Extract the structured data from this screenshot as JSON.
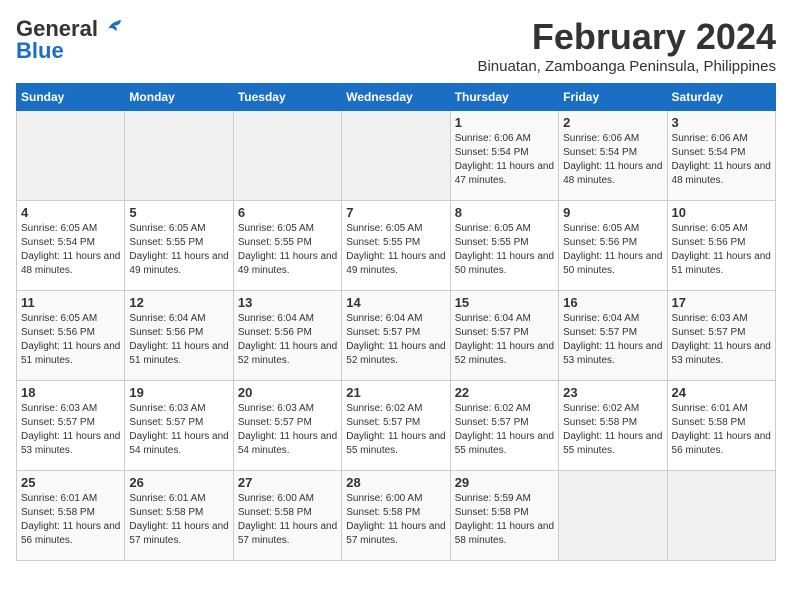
{
  "header": {
    "logo_general": "General",
    "logo_blue": "Blue",
    "month_year": "February 2024",
    "location": "Binuatan, Zamboanga Peninsula, Philippines"
  },
  "days_of_week": [
    "Sunday",
    "Monday",
    "Tuesday",
    "Wednesday",
    "Thursday",
    "Friday",
    "Saturday"
  ],
  "weeks": [
    [
      {
        "day": "",
        "info": ""
      },
      {
        "day": "",
        "info": ""
      },
      {
        "day": "",
        "info": ""
      },
      {
        "day": "",
        "info": ""
      },
      {
        "day": "1",
        "info": "Sunrise: 6:06 AM\nSunset: 5:54 PM\nDaylight: 11 hours and 47 minutes."
      },
      {
        "day": "2",
        "info": "Sunrise: 6:06 AM\nSunset: 5:54 PM\nDaylight: 11 hours and 48 minutes."
      },
      {
        "day": "3",
        "info": "Sunrise: 6:06 AM\nSunset: 5:54 PM\nDaylight: 11 hours and 48 minutes."
      }
    ],
    [
      {
        "day": "4",
        "info": "Sunrise: 6:05 AM\nSunset: 5:54 PM\nDaylight: 11 hours and 48 minutes."
      },
      {
        "day": "5",
        "info": "Sunrise: 6:05 AM\nSunset: 5:55 PM\nDaylight: 11 hours and 49 minutes."
      },
      {
        "day": "6",
        "info": "Sunrise: 6:05 AM\nSunset: 5:55 PM\nDaylight: 11 hours and 49 minutes."
      },
      {
        "day": "7",
        "info": "Sunrise: 6:05 AM\nSunset: 5:55 PM\nDaylight: 11 hours and 49 minutes."
      },
      {
        "day": "8",
        "info": "Sunrise: 6:05 AM\nSunset: 5:55 PM\nDaylight: 11 hours and 50 minutes."
      },
      {
        "day": "9",
        "info": "Sunrise: 6:05 AM\nSunset: 5:56 PM\nDaylight: 11 hours and 50 minutes."
      },
      {
        "day": "10",
        "info": "Sunrise: 6:05 AM\nSunset: 5:56 PM\nDaylight: 11 hours and 51 minutes."
      }
    ],
    [
      {
        "day": "11",
        "info": "Sunrise: 6:05 AM\nSunset: 5:56 PM\nDaylight: 11 hours and 51 minutes."
      },
      {
        "day": "12",
        "info": "Sunrise: 6:04 AM\nSunset: 5:56 PM\nDaylight: 11 hours and 51 minutes."
      },
      {
        "day": "13",
        "info": "Sunrise: 6:04 AM\nSunset: 5:56 PM\nDaylight: 11 hours and 52 minutes."
      },
      {
        "day": "14",
        "info": "Sunrise: 6:04 AM\nSunset: 5:57 PM\nDaylight: 11 hours and 52 minutes."
      },
      {
        "day": "15",
        "info": "Sunrise: 6:04 AM\nSunset: 5:57 PM\nDaylight: 11 hours and 52 minutes."
      },
      {
        "day": "16",
        "info": "Sunrise: 6:04 AM\nSunset: 5:57 PM\nDaylight: 11 hours and 53 minutes."
      },
      {
        "day": "17",
        "info": "Sunrise: 6:03 AM\nSunset: 5:57 PM\nDaylight: 11 hours and 53 minutes."
      }
    ],
    [
      {
        "day": "18",
        "info": "Sunrise: 6:03 AM\nSunset: 5:57 PM\nDaylight: 11 hours and 53 minutes."
      },
      {
        "day": "19",
        "info": "Sunrise: 6:03 AM\nSunset: 5:57 PM\nDaylight: 11 hours and 54 minutes."
      },
      {
        "day": "20",
        "info": "Sunrise: 6:03 AM\nSunset: 5:57 PM\nDaylight: 11 hours and 54 minutes."
      },
      {
        "day": "21",
        "info": "Sunrise: 6:02 AM\nSunset: 5:57 PM\nDaylight: 11 hours and 55 minutes."
      },
      {
        "day": "22",
        "info": "Sunrise: 6:02 AM\nSunset: 5:57 PM\nDaylight: 11 hours and 55 minutes."
      },
      {
        "day": "23",
        "info": "Sunrise: 6:02 AM\nSunset: 5:58 PM\nDaylight: 11 hours and 55 minutes."
      },
      {
        "day": "24",
        "info": "Sunrise: 6:01 AM\nSunset: 5:58 PM\nDaylight: 11 hours and 56 minutes."
      }
    ],
    [
      {
        "day": "25",
        "info": "Sunrise: 6:01 AM\nSunset: 5:58 PM\nDaylight: 11 hours and 56 minutes."
      },
      {
        "day": "26",
        "info": "Sunrise: 6:01 AM\nSunset: 5:58 PM\nDaylight: 11 hours and 57 minutes."
      },
      {
        "day": "27",
        "info": "Sunrise: 6:00 AM\nSunset: 5:58 PM\nDaylight: 11 hours and 57 minutes."
      },
      {
        "day": "28",
        "info": "Sunrise: 6:00 AM\nSunset: 5:58 PM\nDaylight: 11 hours and 57 minutes."
      },
      {
        "day": "29",
        "info": "Sunrise: 5:59 AM\nSunset: 5:58 PM\nDaylight: 11 hours and 58 minutes."
      },
      {
        "day": "",
        "info": ""
      },
      {
        "day": "",
        "info": ""
      }
    ]
  ]
}
